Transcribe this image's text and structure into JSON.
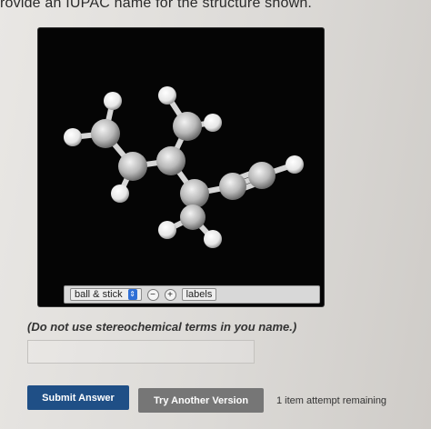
{
  "question": {
    "prompt": "rovide an IUPAC name for the structure shown.",
    "note": "(Do not use stereochemical terms in you name.)",
    "answer_value": ""
  },
  "viewer": {
    "mode_label": "ball & stick",
    "zoom_out": "−",
    "zoom_in": "+",
    "labels_label": "labels"
  },
  "actions": {
    "submit_label": "Submit Answer",
    "try_label": "Try Another Version",
    "attempts_text": "1 item attempt remaining"
  },
  "colors": {
    "submit_bg": "#1f4f86",
    "try_bg": "#767676",
    "viewer_bg": "#050505",
    "carbon": "#b8b8b8",
    "hydrogen": "#f4f4f4"
  }
}
